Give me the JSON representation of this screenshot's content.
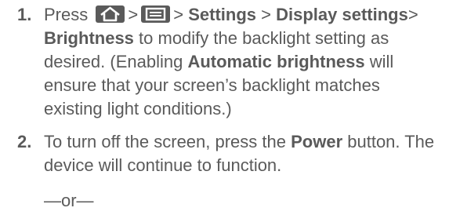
{
  "steps": [
    {
      "number": "1.",
      "press": "Press",
      "sep": ">",
      "icons": [
        "home-key-icon",
        "menu-key-icon"
      ],
      "settings": "Settings",
      "display_settings": "Display settings",
      "brightness": "Brightness",
      "text_a": " to modify the backlight setting as desired. (Enabling ",
      "automatic_brightness": "Automatic brightness",
      "text_b": " will ensure that your screen’s backlight matches existing light conditions.)"
    },
    {
      "number": "2.",
      "text_a": "To turn off the screen, press the ",
      "power": "Power",
      "text_b": " button. The device will continue to function."
    }
  ],
  "or_text": "—or—"
}
